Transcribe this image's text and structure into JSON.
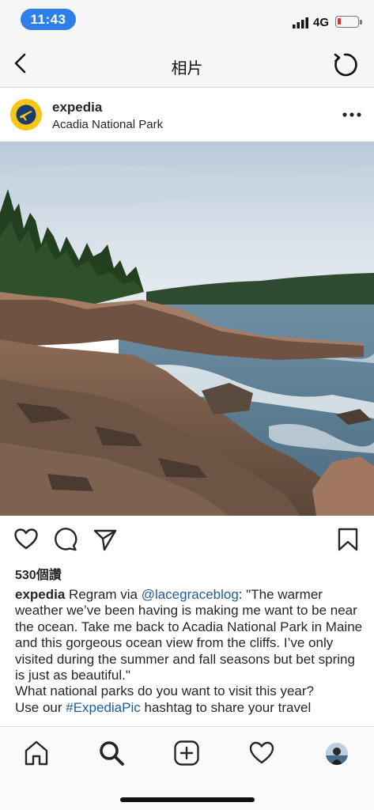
{
  "status_bar": {
    "time": "11:43",
    "network": "4G",
    "battery_level": 0.1,
    "battery_color": "#e0302d",
    "time_pill_color": "#2f7fe8"
  },
  "nav": {
    "title": "相片",
    "back_icon": "chevron-left-icon",
    "refresh_icon": "refresh-icon"
  },
  "post": {
    "username": "expedia",
    "location": "Acadia National Park",
    "avatar_color": "#f5c518",
    "more_icon": "more-horizontal-icon",
    "likes": "530個讚",
    "caption": {
      "username": "expedia",
      "text_before_mention": " Regram via ",
      "mention": "@lacegraceblog",
      "text_after_mention": ": \"The warmer weather we’ve been having is making me want to be near the ocean. Take me back to Acadia National Park in Maine and this gorgeous ocean view from the cliffs. I’ve only visited during the summer and fall seasons but bet spring is just as beautiful.\"",
      "question": "What national parks do you want to visit this year?",
      "text_before_hashtag": "Use our ",
      "hashtag": "#ExpediaPic",
      "text_after_hashtag": " hashtag to share your travel"
    },
    "link_color": "#1f5b99"
  },
  "actions": {
    "like_icon": "heart-icon",
    "comment_icon": "comment-icon",
    "share_icon": "send-icon",
    "save_icon": "bookmark-icon"
  },
  "tab_bar": {
    "items": [
      "home-icon",
      "search-icon",
      "add-post-icon",
      "activity-heart-icon",
      "profile-avatar"
    ]
  }
}
